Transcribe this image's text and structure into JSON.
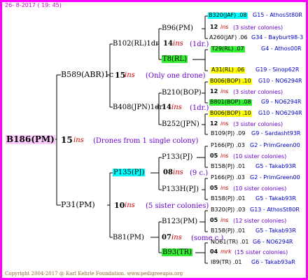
{
  "header": {
    "date": "26- 8-2017 ( 19: 45)"
  },
  "root": {
    "id": "B186(PM)",
    "gen": "15",
    "ins": "ins",
    "note": "(Drones from 1 single colony)"
  },
  "level1": [
    {
      "id": "B589(ABR)1c",
      "gen": "15",
      "ins": "ins",
      "note": "(Only one drone)"
    },
    {
      "id": "P31(PM)",
      "gen": "10",
      "ins": "ins",
      "note": "(5 sister colonies)"
    }
  ],
  "level2": [
    {
      "id": "B102(RL)1dr",
      "gen": "14",
      "ins": "ins",
      "note": "(1dr.)"
    },
    {
      "id": "B408(JPN)1dr",
      "gen": "14",
      "ins": "ins",
      "note": "(1dr.)"
    },
    {
      "id": "P135(PJ)",
      "gen": "08",
      "ins": "ins",
      "note": "(9 c.)"
    },
    {
      "id": "B81(PM)",
      "gen": "07",
      "ins": "ins",
      "note": "(some c.)"
    }
  ],
  "level3": [
    {
      "id": "B96(PM)",
      "gen": "12",
      "ins": "ins",
      "note": "(3 sister colonies)"
    },
    {
      "id": "T8(RL)"
    },
    {
      "id": "B210(BOP)",
      "gen": "12",
      "ins": "ins",
      "note": "(3 sister colonies)"
    },
    {
      "id": "B252(JPN)",
      "gen": "12",
      "ins": "ins",
      "note": "(3 sister colonies)"
    },
    {
      "id": "P133(PJ)",
      "gen": "05",
      "ins": "ins",
      "note": "(10 sister colonies)"
    },
    {
      "id": "P133H(PJ)",
      "gen": "05",
      "ins": "ins",
      "note": "(10 sister colonies)"
    },
    {
      "id": "B123(PM)",
      "gen": "05",
      "ins": "ins",
      "note": "(12 sister colonies)"
    },
    {
      "id": "B93(TR)",
      "gen": "04",
      "ins": "mrk",
      "note": "(15 sister colonies)"
    }
  ],
  "level4": [
    {
      "id": "B320(JAF) .08",
      "tail": "G15 - AthosSt80R"
    },
    {
      "id": "A260(JAF) .06",
      "tail": "G34 - Bayburt98-3"
    },
    {
      "id": "T29(RL) .07",
      "tail": "G4 - Athos00R"
    },
    {
      "id": "A31(RL) .06",
      "tail": "G19 - Sinop62R"
    },
    {
      "id": "B006(BOP) .10",
      "tail": "G10 - NO6294R"
    },
    {
      "id": "B801(BOP) .08",
      "tail": "G9 - NO6294R"
    },
    {
      "id": "B006(BOP) .10",
      "tail": "G10 - NO6294R"
    },
    {
      "id": "B109(PJ) .09",
      "tail": "G9 - Sardasht93R"
    },
    {
      "id": "P166(PJ) .03",
      "tail": "G2 - PrimGreen00"
    },
    {
      "id": "B158(PJ) .01",
      "tail": "G5 - Takab93R"
    },
    {
      "id": "P166(PJ) .03",
      "tail": "G2 - PrimGreen00"
    },
    {
      "id": "B158(PJ) .01",
      "tail": "G5 - Takab93R"
    },
    {
      "id": "B320(PJ) .03",
      "tail": "G13 - AthosSt80R"
    },
    {
      "id": "B158(PJ) .01",
      "tail": "G5 - Takab93R"
    },
    {
      "id": "NO61(TR) .01",
      "tail": "G6 - NO6294R"
    },
    {
      "id": "I89(TR) .01",
      "tail": "G6 - Takab93aR"
    }
  ],
  "footer": {
    "copyright": "Copyright 2004-2017 @ Karl Kehrle Foundation.   www.pedigreeapis.org"
  }
}
